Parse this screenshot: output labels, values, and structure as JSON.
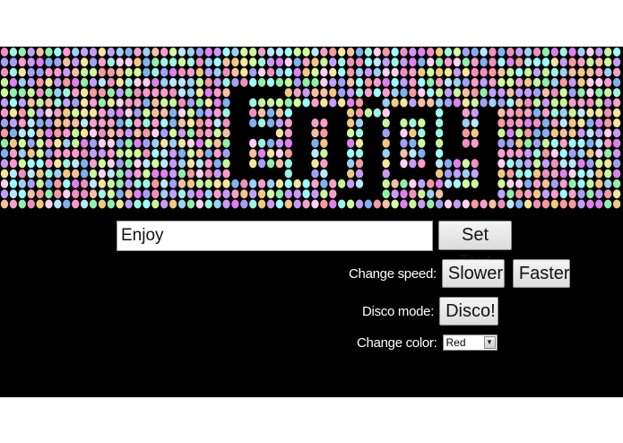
{
  "display": {
    "text": "Enjoy",
    "led_palette": [
      "#f4a0c8",
      "#9ad0f5",
      "#c7f59a",
      "#f5e79a",
      "#c89af5",
      "#9af5e1",
      "#f59aa0",
      "#7fb0f0",
      "#f0c87f",
      "#e07ff0",
      "#8ff0a8",
      "#f08fbf",
      "#a0a0f5",
      "#f5c0a0",
      "#b8e8ff",
      "#ffd0f0",
      "#d0ff9a",
      "#9affff",
      "#ff9ad0",
      "#c0a0ff"
    ]
  },
  "controls": {
    "text_input_value": "Enjoy",
    "set_text_label": "Set Text",
    "speed_label": "Change speed:",
    "slower_label": "Slower",
    "faster_label": "Faster",
    "disco_label": "Disco mode:",
    "disco_button_label": "Disco!",
    "color_label": "Change color:",
    "color_selected": "Red"
  }
}
